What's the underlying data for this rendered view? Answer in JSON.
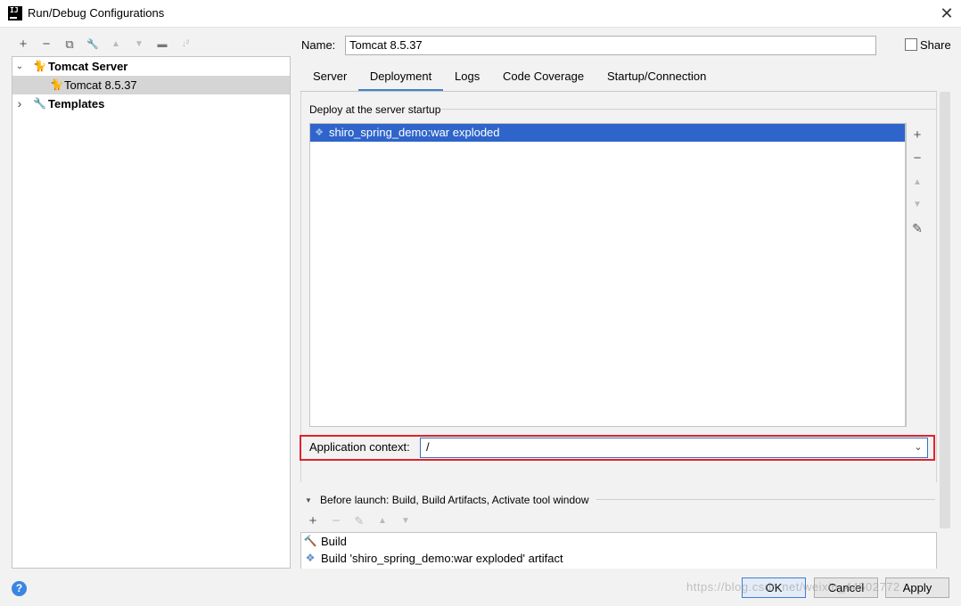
{
  "window": {
    "title": "Run/Debug Configurations",
    "app_icon_text": "IJ",
    "close_glyph": "✕"
  },
  "toolbar": {
    "add": "+",
    "remove": "−",
    "copy": "⧉",
    "edit": "🔧",
    "up": "▲",
    "down": "▼",
    "folder": "▬",
    "sort": "↓²"
  },
  "tree": {
    "server_group": "Tomcat Server",
    "server_item": "Tomcat 8.5.37",
    "templates": "Templates",
    "expanded_glyph": "⌄",
    "collapsed_glyph": "›"
  },
  "name_field": {
    "label": "Name:",
    "value": "Tomcat 8.5.37"
  },
  "share": {
    "label": "Share",
    "checked": false
  },
  "tabs": [
    {
      "label": "Server",
      "active": false
    },
    {
      "label": "Deployment",
      "active": true
    },
    {
      "label": "Logs",
      "active": false
    },
    {
      "label": "Code Coverage",
      "active": false
    },
    {
      "label": "Startup/Connection",
      "active": false
    }
  ],
  "deployment": {
    "group_title": "Deploy at the server startup",
    "artifacts": [
      "shiro_spring_demo:war exploded"
    ],
    "buttons": {
      "add": "+",
      "remove": "−",
      "up": "▲",
      "down": "▼",
      "edit": "✎"
    },
    "app_context_label": "Application context:",
    "app_context_value": "/"
  },
  "before_launch": {
    "title": "Before launch: Build, Build Artifacts, Activate tool window",
    "toggle_glyph": "▼",
    "toolbar": {
      "add": "+",
      "remove": "−",
      "edit": "✎",
      "up": "▲",
      "down": "▼"
    },
    "items": [
      "Build",
      "Build 'shiro_spring_demo:war exploded' artifact"
    ]
  },
  "footer": {
    "help": "?",
    "ok": "OK",
    "cancel": "Cancel",
    "apply": "Apply",
    "watermark": "https://blog.csdn.net/weixin_44502772"
  },
  "colors": {
    "accent": "#4083c9",
    "selection": "#2f65ca",
    "highlight_box": "#e0232b"
  }
}
